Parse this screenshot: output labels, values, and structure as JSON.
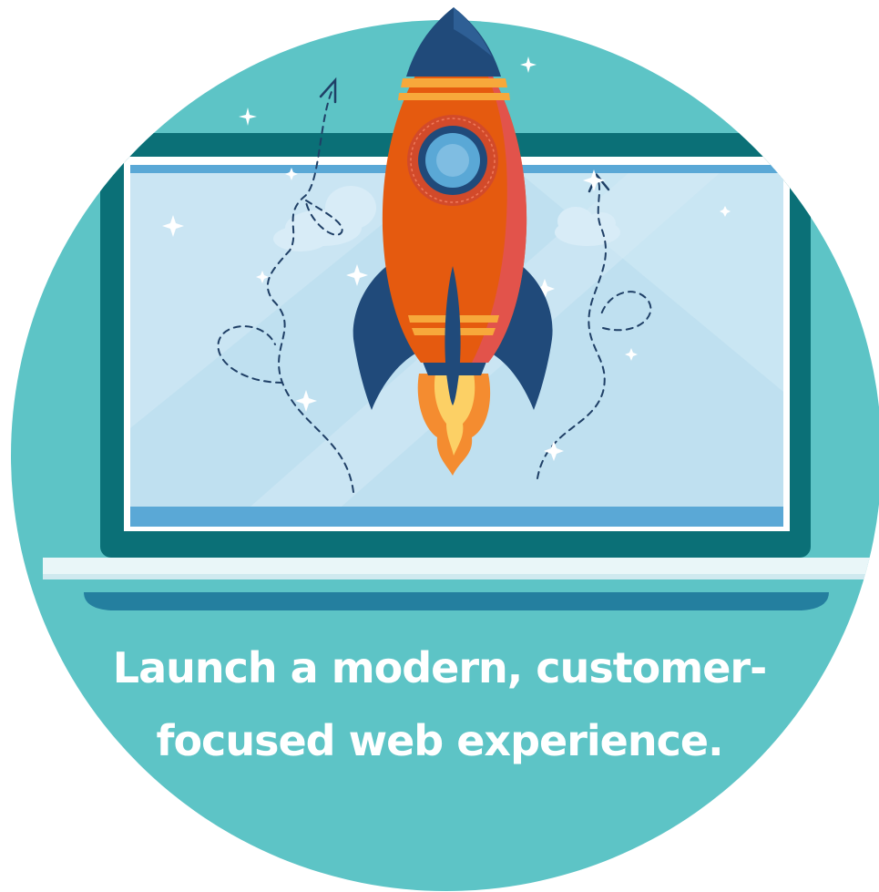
{
  "caption": {
    "line1": "Launch a modern, customer-",
    "line2": "focused web experience."
  },
  "colors": {
    "circle": "#5dc4c6",
    "laptop_frame": "#0b7077",
    "screen_sky": "#bfe0f0",
    "screen_bar": "#5aa8d6",
    "laptop_base": "#e9f6f8",
    "laptop_shadow": "#247f9f",
    "rocket_body": "#e55a0f",
    "rocket_shade": "#e2534b",
    "rocket_navy": "#204a7a",
    "rocket_stripe": "#f7a83b",
    "flame_outer": "#f48c30",
    "flame_inner": "#fcd065"
  },
  "icons": [
    "rocket-icon",
    "sparkle-icon",
    "dashed-arrow-icon",
    "cloud-icon",
    "laptop-icon"
  ]
}
